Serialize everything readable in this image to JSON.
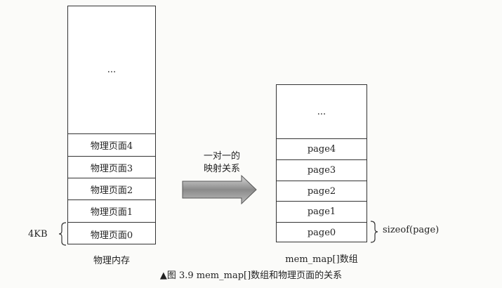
{
  "left_stack": {
    "top_label": "...",
    "cells": [
      "物理页面4",
      "物理页面3",
      "物理页面2",
      "物理页面1",
      "物理页面0"
    ],
    "title": "物理内存",
    "size_label": "4KB"
  },
  "arrow": {
    "line1": "一对一的",
    "line2": "映射关系"
  },
  "right_stack": {
    "top_label": "...",
    "cells": [
      "page4",
      "page3",
      "page2",
      "page1",
      "page0"
    ],
    "title": "mem_map[]数组",
    "size_label": "sizeof(page)"
  },
  "caption": "▲图 3.9    mem_map[]数组和物理页面的关系"
}
